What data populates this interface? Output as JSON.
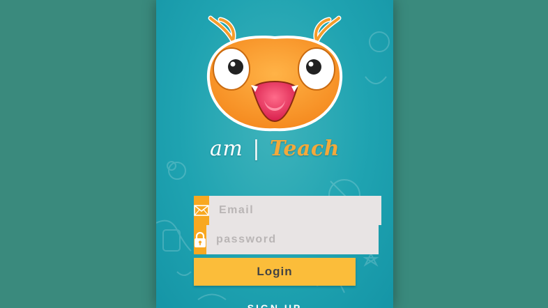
{
  "brand": {
    "prefix": "am",
    "separator": "|",
    "name": "Teach"
  },
  "login_form": {
    "email_placeholder": "Email",
    "password_placeholder": "password",
    "login_label": "Login",
    "signup_label": "SIGN UP"
  },
  "icons": {
    "email": "envelope-icon",
    "password": "lock-icon"
  },
  "colors": {
    "background": "#3a8a7d",
    "phone_bg": "#1fa3b1",
    "accent": "#f8a820",
    "button": "#fbbd3a",
    "input_bg": "#e8e4e4",
    "brand_accent": "#f3a93b"
  }
}
